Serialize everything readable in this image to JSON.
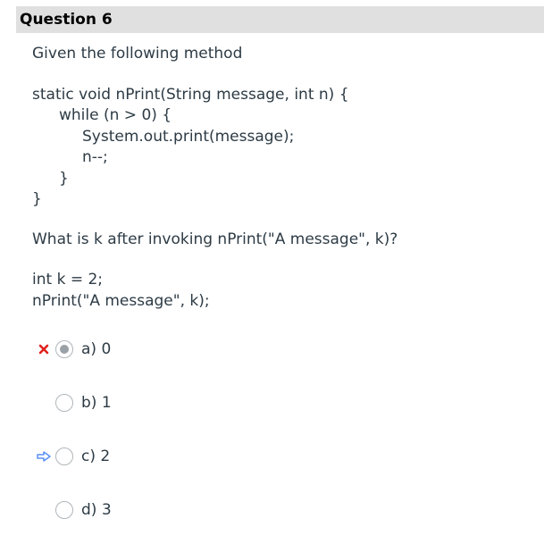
{
  "question": {
    "title": "Question 6",
    "intro": "Given the following method",
    "code": [
      "static void nPrint(String message, int n) {",
      "while (n > 0) {",
      "System.out.print(message);",
      "n--;",
      "}",
      "}"
    ],
    "prompt": "What is k after invoking nPrint(\"A message\", k)?",
    "snippet": [
      "int k = 2;",
      "nPrint(\"A message\", k);"
    ],
    "answers": [
      {
        "label": "a) 0",
        "selected": true,
        "marker": "incorrect-x-icon"
      },
      {
        "label": "b) 1",
        "selected": false,
        "marker": ""
      },
      {
        "label": "c) 2",
        "selected": false,
        "marker": "correct-answer-arrow-icon"
      },
      {
        "label": "d) 3",
        "selected": false,
        "marker": ""
      }
    ]
  },
  "colors": {
    "header_bg": "#e0e0e0",
    "text": "#2d3b45",
    "incorrect": "#e0211d",
    "correct_arrow": "#5b8ff9"
  }
}
